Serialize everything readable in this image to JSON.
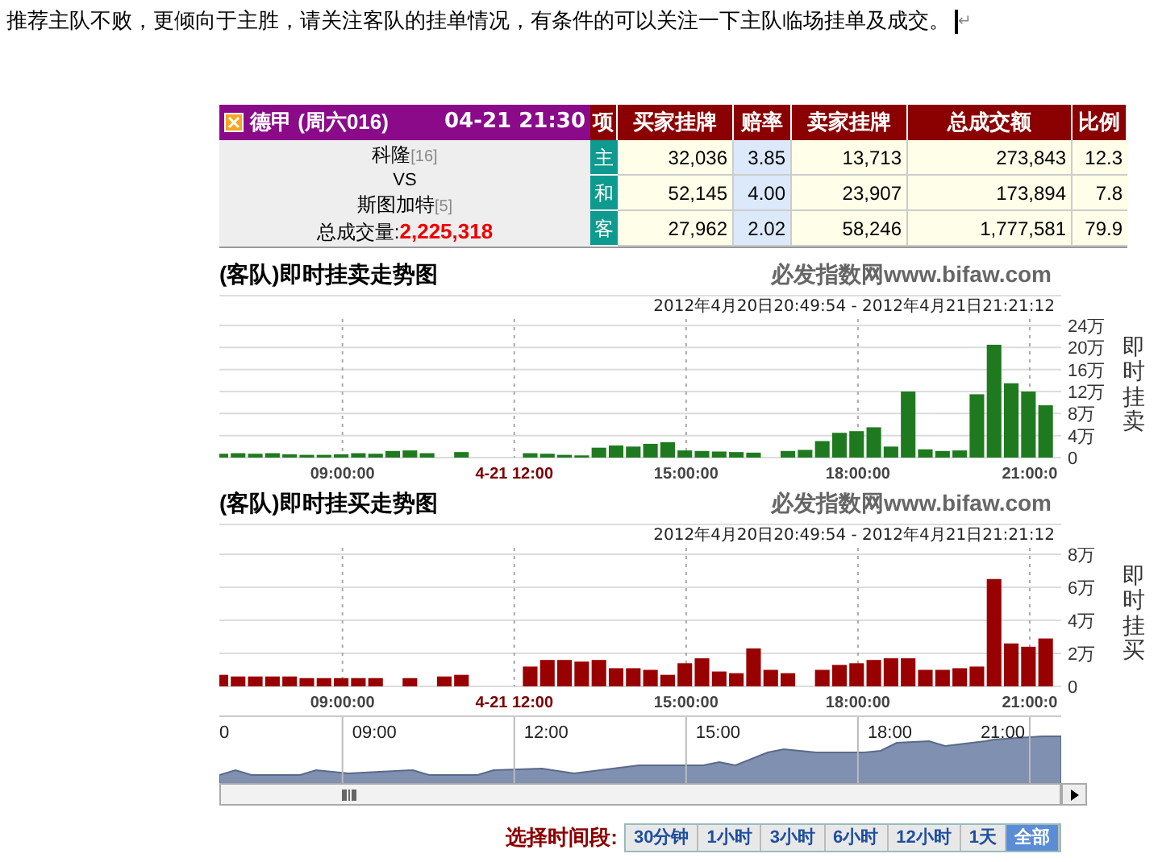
{
  "note": "推荐主队不败，更倾向于主胜，请关注客队的挂单情况，有条件的可以关注一下主队临场挂单及成交。",
  "end_mark": "↵",
  "match": {
    "league": "德甲 (周六016)",
    "time": "04-21 21:30",
    "home": "科隆",
    "home_rank": "[16]",
    "vs": "VS",
    "away": "斯图加特",
    "away_rank": "[5]",
    "volume_label": "总成交量:",
    "volume": "2,225,318"
  },
  "table": {
    "columns": [
      "项",
      "买家挂牌",
      "赔率",
      "卖家挂牌",
      "总成交额",
      "比例"
    ],
    "rows": [
      {
        "item": "主",
        "buy": "32,036",
        "odds": "3.85",
        "sell": "13,713",
        "total": "273,843",
        "ratio": "12.3"
      },
      {
        "item": "和",
        "buy": "52,145",
        "odds": "4.00",
        "sell": "23,907",
        "total": "173,894",
        "ratio": "7.8"
      },
      {
        "item": "客",
        "buy": "27,962",
        "odds": "2.02",
        "sell": "58,246",
        "total": "1,777,581",
        "ratio": "79.9"
      }
    ]
  },
  "charts": [
    {
      "title": "(客队)即时挂卖走势图",
      "source": "必发指数网www.bifaw.com",
      "range": "2012年4月20日20:49:54 - 2012年4月21日21:21:12",
      "xtick_marked": [
        false,
        true,
        false,
        false,
        false
      ],
      "chart_data": {
        "type": "bar",
        "grid": true,
        "xlim": [
          6.85,
          21.55
        ],
        "ylim": [
          0,
          24
        ],
        "x": [
          6.9,
          7.2,
          7.5,
          7.8,
          8.1,
          8.4,
          8.7,
          9.0,
          9.3,
          9.6,
          9.9,
          10.2,
          10.5,
          10.8,
          11.1,
          11.4,
          11.7,
          12.0,
          12.3,
          12.6,
          12.9,
          13.2,
          13.5,
          13.8,
          14.1,
          14.4,
          14.7,
          15.0,
          15.3,
          15.6,
          15.9,
          16.2,
          16.5,
          16.8,
          17.1,
          17.4,
          17.7,
          18.0,
          18.3,
          18.6,
          18.9,
          19.2,
          19.5,
          19.8,
          20.1,
          20.4,
          20.7,
          21.0,
          21.3
        ],
        "series": [
          {
            "name": "即时挂卖",
            "color": "#1f7a1f",
            "values": [
              0.7,
              0.8,
              0.7,
              0.8,
              0.6,
              0.5,
              0.5,
              0.6,
              0.8,
              0.7,
              1.2,
              1.3,
              0.8,
              null,
              1.0,
              null,
              null,
              null,
              0.8,
              0.7,
              0.5,
              0.4,
              1.8,
              2.2,
              2.0,
              2.5,
              2.8,
              1.3,
              1.2,
              1.1,
              1.0,
              0.9,
              null,
              1.2,
              1.4,
              3.0,
              4.5,
              4.8,
              5.5,
              2.0,
              12.0,
              1.5,
              1.2,
              1.3,
              11.5,
              20.5,
              13.5,
              12.0,
              9.5
            ]
          }
        ],
        "xticks": [
          {
            "value": 9,
            "label": "09:00:00"
          },
          {
            "value": 12,
            "label": "4-21 12:00"
          },
          {
            "value": 15,
            "label": "15:00:00"
          },
          {
            "value": 18,
            "label": "18:00:00"
          },
          {
            "value": 21,
            "label": "21:00:0"
          }
        ],
        "yticks": [
          {
            "value": 0,
            "label": "0"
          },
          {
            "value": 4,
            "label": "4万"
          },
          {
            "value": 8,
            "label": "8万"
          },
          {
            "value": 12,
            "label": "12万"
          },
          {
            "value": 16,
            "label": "16万"
          },
          {
            "value": 20,
            "label": "20万"
          },
          {
            "value": 24,
            "label": "24万"
          }
        ]
      }
    },
    {
      "title": "(客队)即时挂买走势图",
      "source": "必发指数网www.bifaw.com",
      "range": "2012年4月20日20:49:54 - 2012年4月21日21:21:12",
      "xtick_marked": [
        false,
        true,
        false,
        false,
        false
      ],
      "chart_data": {
        "type": "bar",
        "grid": true,
        "xlim": [
          6.85,
          21.55
        ],
        "ylim": [
          0,
          8
        ],
        "x": [
          6.9,
          7.2,
          7.5,
          7.8,
          8.1,
          8.4,
          8.7,
          9.0,
          9.3,
          9.6,
          9.9,
          10.2,
          10.5,
          10.8,
          11.1,
          11.4,
          11.7,
          12.0,
          12.3,
          12.6,
          12.9,
          13.2,
          13.5,
          13.8,
          14.1,
          14.4,
          14.7,
          15.0,
          15.3,
          15.6,
          15.9,
          16.2,
          16.5,
          16.8,
          17.1,
          17.4,
          17.7,
          18.0,
          18.3,
          18.6,
          18.9,
          19.2,
          19.5,
          19.8,
          20.1,
          20.4,
          20.7,
          21.0,
          21.3
        ],
        "series": [
          {
            "name": "即时挂买",
            "color": "#990000",
            "values": [
              0.7,
              0.6,
              0.6,
              0.6,
              0.6,
              0.5,
              0.5,
              0.5,
              0.5,
              0.5,
              null,
              0.5,
              null,
              0.6,
              0.7,
              null,
              null,
              null,
              1.2,
              1.6,
              1.6,
              1.5,
              1.6,
              1.1,
              1.1,
              1.0,
              0.7,
              1.4,
              1.7,
              0.9,
              0.8,
              2.3,
              1.0,
              0.8,
              null,
              1.0,
              1.3,
              1.4,
              1.6,
              1.7,
              1.7,
              1.0,
              1.0,
              1.1,
              1.2,
              6.5,
              2.6,
              2.4,
              2.9
            ]
          }
        ],
        "xticks": [
          {
            "value": 9,
            "label": "09:00:00"
          },
          {
            "value": 12,
            "label": "4-21 12:00"
          },
          {
            "value": 15,
            "label": "15:00:00"
          },
          {
            "value": 18,
            "label": "18:00:00"
          },
          {
            "value": 21,
            "label": "21:00:0"
          }
        ],
        "yticks": [
          {
            "value": 0,
            "label": "0"
          },
          {
            "value": 2,
            "label": "2万"
          },
          {
            "value": 4,
            "label": "4万"
          },
          {
            "value": 6,
            "label": "6万"
          },
          {
            "value": 8,
            "label": "8万"
          }
        ]
      }
    }
  ],
  "navigator": {
    "labels": [
      "0",
      "09:00",
      "12:00",
      "15:00",
      "18:00",
      "21:00"
    ]
  },
  "time_range": {
    "label": "选择时间段:",
    "options": [
      {
        "label": "30分钟",
        "selected": false
      },
      {
        "label": "1小时",
        "selected": false
      },
      {
        "label": "3小时",
        "selected": false
      },
      {
        "label": "6小时",
        "selected": false
      },
      {
        "label": "12小时",
        "selected": false
      },
      {
        "label": "1天",
        "selected": false
      },
      {
        "label": "全部",
        "selected": true
      }
    ]
  }
}
